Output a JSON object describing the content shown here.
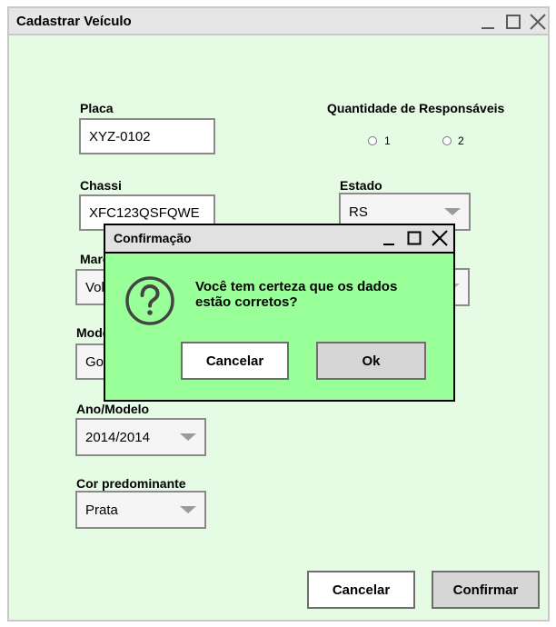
{
  "window": {
    "title": "Cadastrar Veículo",
    "controls": [
      "minimize-icon",
      "maximize-icon",
      "close-icon"
    ]
  },
  "form": {
    "placa": {
      "label": "Placa",
      "value": "XYZ-0102"
    },
    "chassi": {
      "label": "Chassi",
      "value": "XFC123QSFQWE"
    },
    "marca": {
      "label": "Marca",
      "value": "Volkswagen"
    },
    "modelo": {
      "label": "Modelo",
      "value": "Gol"
    },
    "ano_modelo": {
      "label": "Ano/Modelo",
      "value": "2014/2014"
    },
    "cor": {
      "label": "Cor predominante",
      "value": "Prata"
    },
    "responsaveis": {
      "label": "Quantidade de Responsáveis",
      "options": [
        "1",
        "2"
      ]
    },
    "estado": {
      "label": "Estado",
      "value": "RS"
    },
    "cidade": {
      "value": ""
    }
  },
  "footer": {
    "cancel_label": "Cancelar",
    "confirm_label": "Confirmar"
  },
  "dialog": {
    "title": "Confirmação",
    "icon": "question-icon",
    "message_line1": "Você tem certeza que os dados",
    "message_line2": "estão corretos?",
    "cancel_label": "Cancelar",
    "ok_label": "Ok"
  },
  "colors": {
    "window_background": "#e5fbe3",
    "dialog_background": "#99ff99",
    "titlebar": "#e6e6e6"
  }
}
